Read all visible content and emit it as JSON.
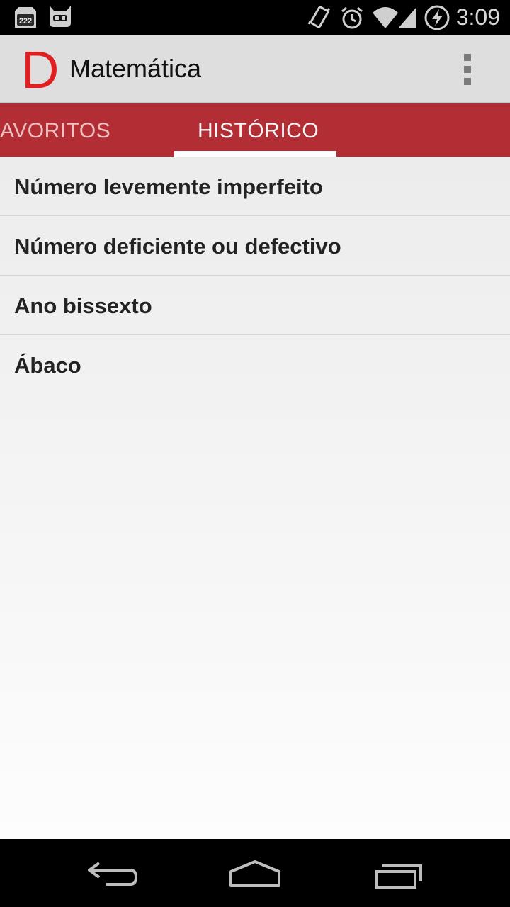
{
  "status_bar": {
    "notification_badge": "222",
    "time": "3:09",
    "icons": [
      "notification-222-icon",
      "cyanogen-mod-icon",
      "vibrate-icon",
      "alarm-icon",
      "wifi-icon",
      "cell-signal-icon",
      "battery-charging-icon"
    ]
  },
  "action_bar": {
    "logo_letter": "D",
    "title": "Matemática",
    "overflow_icon": "more-vert-icon"
  },
  "tabs": [
    {
      "label": "AVORITOS",
      "selected": false
    },
    {
      "label": "HISTÓRICO",
      "selected": true
    }
  ],
  "history_items": [
    "Número levemente imperfeito",
    "Número deficiente ou defectivo",
    "Ano bissexto",
    "Ábaco"
  ],
  "nav_bar": {
    "icons": [
      "back-icon",
      "home-icon",
      "recents-icon"
    ]
  },
  "colors": {
    "accent": "#b22e34",
    "logo": "#e02020",
    "action_bar": "#dedede"
  }
}
